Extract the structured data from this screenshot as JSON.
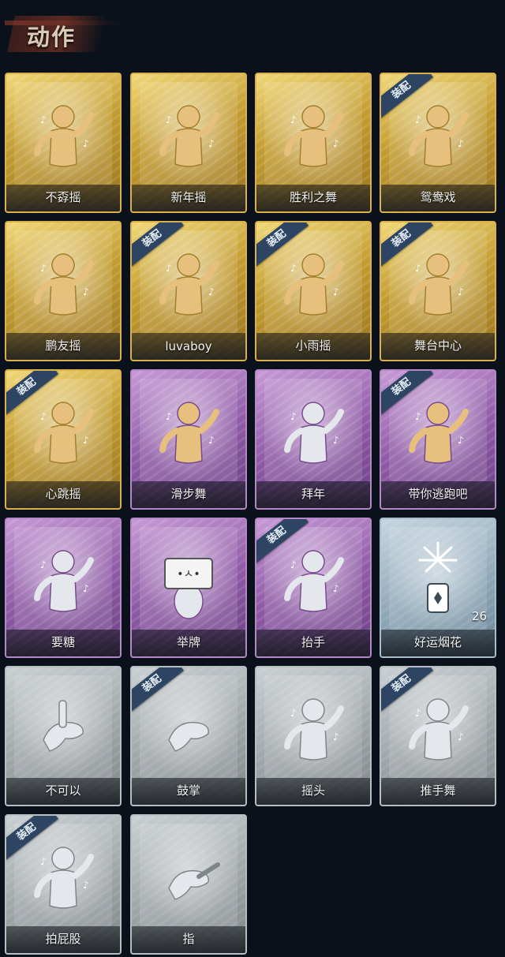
{
  "section_title": "动作",
  "equip_badge": "装配",
  "colors": {
    "gold": "#c29b2f",
    "purple": "#8f5ba6",
    "blue": "#8ea7b8",
    "gray": "#9ea4a8"
  },
  "cards": [
    {
      "label": "不孬摇",
      "rarity": "gold",
      "equipped": false,
      "icon": "dance-figure-icon"
    },
    {
      "label": "新年摇",
      "rarity": "gold",
      "equipped": false,
      "icon": "dance-figure-icon"
    },
    {
      "label": "胜利之舞",
      "rarity": "gold",
      "equipped": false,
      "icon": "dance-figure-icon"
    },
    {
      "label": "鸳鸯戏",
      "rarity": "gold",
      "equipped": true,
      "icon": "dance-figure-icon"
    },
    {
      "label": "鹏友摇",
      "rarity": "gold",
      "equipped": false,
      "icon": "dance-figure-icon"
    },
    {
      "label": "luvaboy",
      "rarity": "gold",
      "equipped": true,
      "icon": "dance-figure-icon"
    },
    {
      "label": "小雨摇",
      "rarity": "gold",
      "equipped": true,
      "icon": "dance-figure-icon"
    },
    {
      "label": "舞台中心",
      "rarity": "gold",
      "equipped": true,
      "icon": "dance-figure-icon"
    },
    {
      "label": "心跳摇",
      "rarity": "gold",
      "equipped": true,
      "icon": "dance-figure-icon"
    },
    {
      "label": "滑步舞",
      "rarity": "purple",
      "equipped": false,
      "icon": "dance-figure-icon"
    },
    {
      "label": "拜年",
      "rarity": "purple",
      "equipped": false,
      "icon": "bow-figure-icon"
    },
    {
      "label": "带你逃跑吧",
      "rarity": "purple",
      "equipped": true,
      "icon": "dance-figure-icon"
    },
    {
      "label": "要糖",
      "rarity": "purple",
      "equipped": false,
      "icon": "reach-figure-icon"
    },
    {
      "label": "举牌",
      "rarity": "purple",
      "equipped": false,
      "icon": "sign-figure-icon"
    },
    {
      "label": "抬手",
      "rarity": "purple",
      "equipped": true,
      "icon": "raise-hand-figure-icon"
    },
    {
      "label": "好运烟花",
      "rarity": "blue",
      "equipped": false,
      "icon": "firework-icon",
      "count": "26"
    },
    {
      "label": "不可以",
      "rarity": "gray",
      "equipped": false,
      "icon": "finger-wag-icon"
    },
    {
      "label": "鼓掌",
      "rarity": "gray",
      "equipped": true,
      "icon": "clap-icon"
    },
    {
      "label": "摇头",
      "rarity": "gray",
      "equipped": false,
      "icon": "head-shake-figure-icon"
    },
    {
      "label": "推手舞",
      "rarity": "gray",
      "equipped": true,
      "icon": "push-dance-figure-icon"
    },
    {
      "label": "拍屁股",
      "rarity": "gray",
      "equipped": true,
      "icon": "slap-figure-icon"
    },
    {
      "label": "指",
      "rarity": "gray",
      "equipped": false,
      "icon": "point-hand-icon"
    }
  ]
}
